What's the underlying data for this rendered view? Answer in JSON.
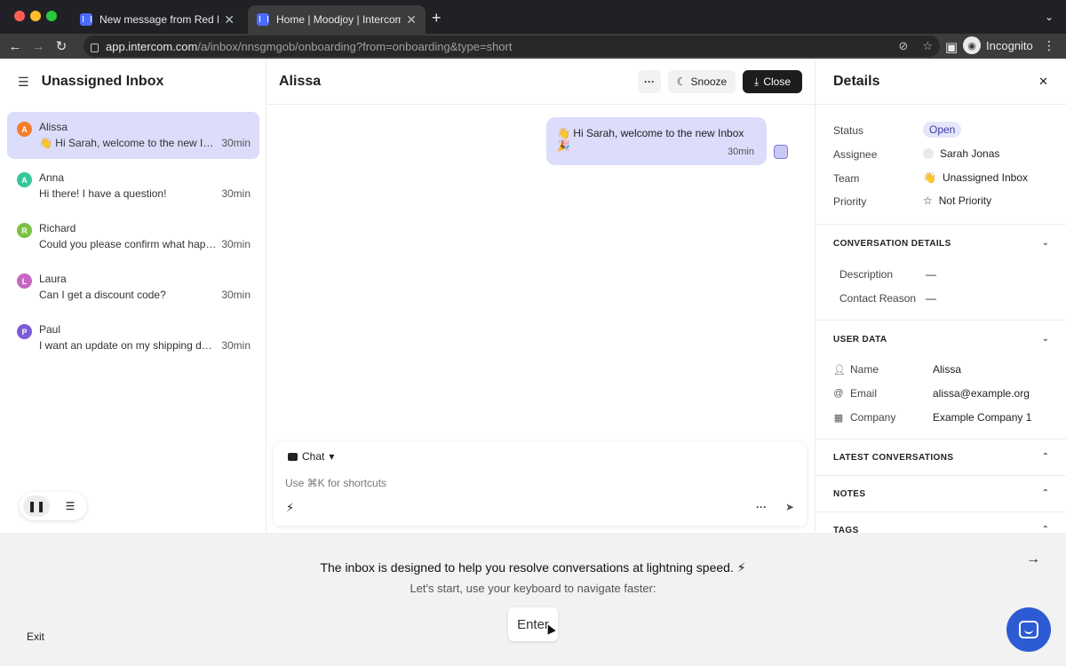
{
  "browser": {
    "tabs": [
      {
        "title": "New message from Red Lamp"
      },
      {
        "title": "Home | Moodjoy | Intercom"
      }
    ],
    "url": {
      "host": "app.intercom.com",
      "path": "/a/inbox/nnsgmgob/onboarding?from=onboarding&type=short"
    },
    "profile_label": "Incognito"
  },
  "inbox": {
    "title": "Unassigned Inbox",
    "conversations": [
      {
        "initial": "A",
        "name": "Alissa",
        "preview": "👋 Hi Sarah, welcome to the new Inbox 🎉",
        "time": "30min",
        "color": "#f57c2b",
        "selected": true
      },
      {
        "initial": "A",
        "name": "Anna",
        "preview": "Hi there! I have a question!",
        "time": "30min",
        "color": "#34c79a"
      },
      {
        "initial": "R",
        "name": "Richard",
        "preview": "Could you please confirm what happened?",
        "time": "30min",
        "color": "#7ac142"
      },
      {
        "initial": "L",
        "name": "Laura",
        "preview": "Can I get a discount code?",
        "time": "30min",
        "color": "#c766c0"
      },
      {
        "initial": "P",
        "name": "Paul",
        "preview": "I want an update on my shipping dates.",
        "time": "30min",
        "color": "#7b5cd6"
      }
    ]
  },
  "conversation": {
    "name": "Alissa",
    "more_label": "···",
    "snooze_label": "Snooze",
    "close_label": "Close",
    "message": {
      "text": "👋 Hi Sarah, welcome to the new Inbox 🎉",
      "time": "30min"
    },
    "composer": {
      "mode": "Chat",
      "placeholder": "Use ⌘K for shortcuts"
    }
  },
  "details": {
    "title": "Details",
    "fields": {
      "status": {
        "label": "Status",
        "value": "Open"
      },
      "assignee": {
        "label": "Assignee",
        "value": "Sarah Jonas"
      },
      "team": {
        "label": "Team",
        "value": "Unassigned Inbox"
      },
      "priority": {
        "label": "Priority",
        "value": "Not Priority"
      }
    },
    "conversation_details": {
      "title": "CONVERSATION DETAILS",
      "description": {
        "label": "Description",
        "value": "—"
      },
      "contact_reason": {
        "label": "Contact Reason",
        "value": "—"
      }
    },
    "user_data": {
      "title": "USER DATA",
      "name": {
        "label": "Name",
        "value": "Alissa"
      },
      "email": {
        "label": "Email",
        "value": "alissa@example.org"
      },
      "company": {
        "label": "Company",
        "value": "Example Company 1"
      }
    },
    "sections": [
      "LATEST CONVERSATIONS",
      "NOTES",
      "TAGS"
    ]
  },
  "onboarding": {
    "line1": "The inbox is designed to help you resolve conversations at lightning speed. ⚡",
    "line2": "Let's start, use your keyboard to navigate faster:",
    "key": "Enter",
    "exit_label": "Exit"
  },
  "colors": {
    "accent": "#dcdcfb",
    "brand": "#2d5bd3",
    "status_pill": "#e5e5fb"
  }
}
